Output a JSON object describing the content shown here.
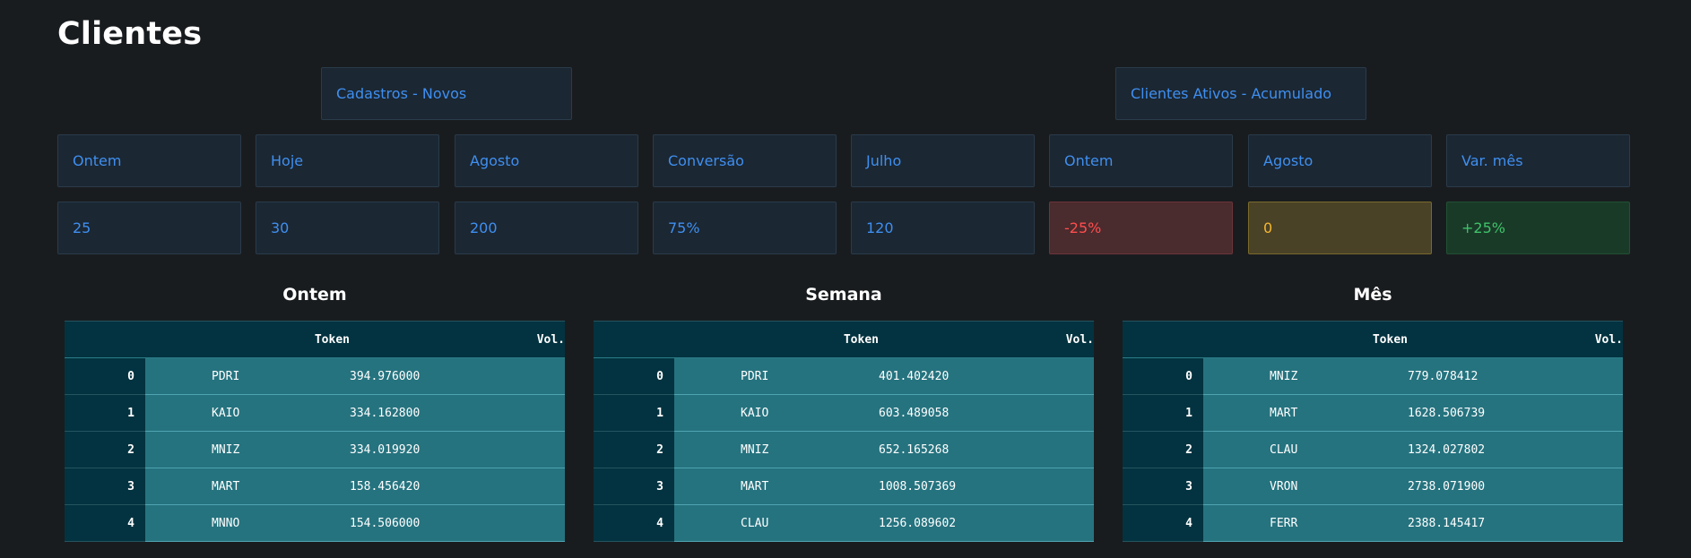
{
  "page": {
    "title": "Clientes"
  },
  "sections": {
    "cadastros": "Cadastros - Novos",
    "ativos": "Clientes Ativos - Acumulado"
  },
  "metrics": [
    {
      "label": "Ontem",
      "value": "25"
    },
    {
      "label": "Hoje",
      "value": "30"
    },
    {
      "label": "Agosto",
      "value": "200"
    },
    {
      "label": "Conversão",
      "value": "75%"
    },
    {
      "label": "Julho",
      "value": "120"
    },
    {
      "label": "Ontem",
      "value": "-25%"
    },
    {
      "label": "Agosto",
      "value": "0"
    },
    {
      "label": "Var. mês",
      "value": "+25%"
    }
  ],
  "status_colors": {
    "negative": "#ff4d4d",
    "neutral": "#f5b731",
    "positive": "#3fc26a",
    "accent": "#3f8ff0"
  },
  "tables": [
    {
      "title": "Ontem",
      "headers": {
        "token": "Token",
        "vol": "Vol."
      },
      "rows": [
        {
          "idx": "0",
          "token": "PDRI",
          "vol": "394.976000"
        },
        {
          "idx": "1",
          "token": "KAIO",
          "vol": "334.162800"
        },
        {
          "idx": "2",
          "token": "MNIZ",
          "vol": "334.019920"
        },
        {
          "idx": "3",
          "token": "MART",
          "vol": "158.456420"
        },
        {
          "idx": "4",
          "token": "MNNO",
          "vol": "154.506000"
        }
      ]
    },
    {
      "title": "Semana",
      "headers": {
        "token": "Token",
        "vol": "Vol."
      },
      "rows": [
        {
          "idx": "0",
          "token": "PDRI",
          "vol": "401.402420"
        },
        {
          "idx": "1",
          "token": "KAIO",
          "vol": "603.489058"
        },
        {
          "idx": "2",
          "token": "MNIZ",
          "vol": "652.165268"
        },
        {
          "idx": "3",
          "token": "MART",
          "vol": "1008.507369"
        },
        {
          "idx": "4",
          "token": "CLAU",
          "vol": "1256.089602"
        }
      ]
    },
    {
      "title": "Mês",
      "headers": {
        "token": "Token",
        "vol": "Vol."
      },
      "rows": [
        {
          "idx": "0",
          "token": "MNIZ",
          "vol": "779.078412"
        },
        {
          "idx": "1",
          "token": "MART",
          "vol": "1628.506739"
        },
        {
          "idx": "2",
          "token": "CLAU",
          "vol": "1324.027802"
        },
        {
          "idx": "3",
          "token": "VRON",
          "vol": "2738.071900"
        },
        {
          "idx": "4",
          "token": "FERR",
          "vol": "2388.145417"
        }
      ]
    }
  ]
}
